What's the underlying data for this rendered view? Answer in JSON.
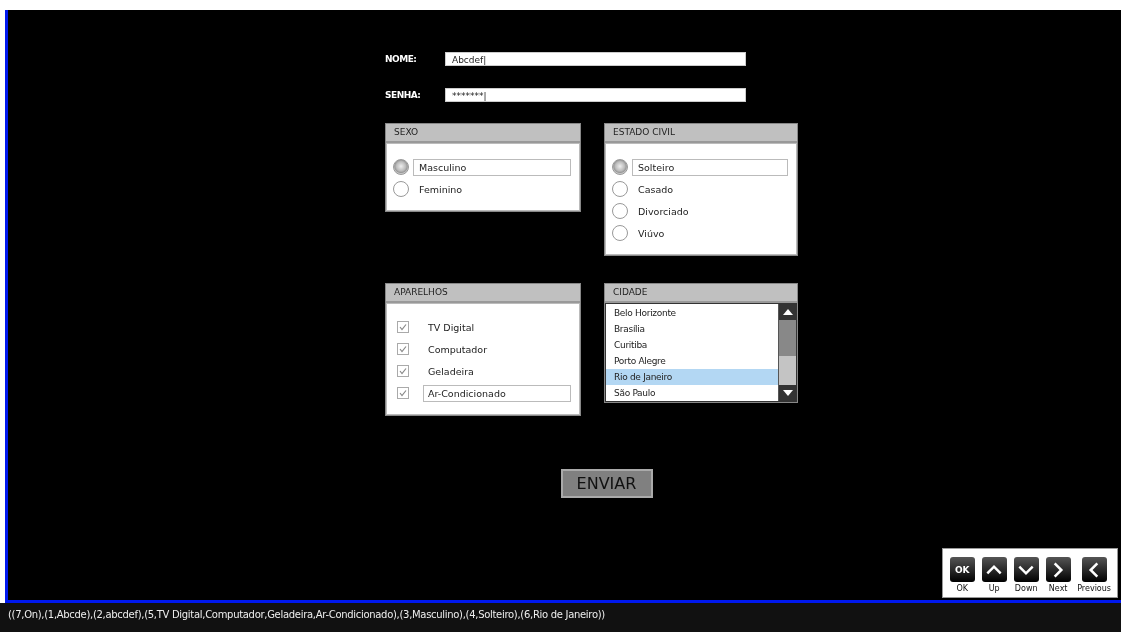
{
  "fields": [
    {
      "label": "NOME:",
      "value": "Abcdef|"
    },
    {
      "label": "SENHA:",
      "value": "*******|"
    }
  ],
  "groups": [
    {
      "kind": "radio",
      "title": "SEXO",
      "items": [
        {
          "label": "Masculino",
          "selected": true
        },
        {
          "label": "Feminino",
          "selected": false
        }
      ]
    },
    {
      "kind": "radio",
      "title": "ESTADO CIVIL",
      "items": [
        {
          "label": "Solteiro",
          "selected": true
        },
        {
          "label": "Casado",
          "selected": false
        },
        {
          "label": "Divorciado",
          "selected": false
        },
        {
          "label": "Viúvo",
          "selected": false
        }
      ]
    },
    {
      "kind": "checkbox",
      "title": "APARELHOS",
      "items": [
        {
          "label": "TV Digital",
          "checked": true,
          "focused": false
        },
        {
          "label": "Computador",
          "checked": true,
          "focused": false
        },
        {
          "label": "Geladeira",
          "checked": true,
          "focused": false
        },
        {
          "label": "Ar-Condicionado",
          "checked": true,
          "focused": true
        }
      ]
    },
    {
      "kind": "list",
      "title": "CIDADE",
      "items": [
        {
          "label": "Belo Horizonte",
          "selected": false
        },
        {
          "label": "Brasília",
          "selected": false
        },
        {
          "label": "Curitiba",
          "selected": false
        },
        {
          "label": "Porto Alegre",
          "selected": false
        },
        {
          "label": "Rio de Janeiro",
          "selected": true
        },
        {
          "label": "São Paulo",
          "selected": false
        }
      ]
    }
  ],
  "submit_button": "ENVIAR",
  "nav_buttons": [
    {
      "kind": "ok",
      "key": "OK",
      "label": "OK"
    },
    {
      "kind": "up",
      "label": "Up"
    },
    {
      "kind": "down",
      "label": "Down"
    },
    {
      "kind": "next",
      "label": "Next"
    },
    {
      "kind": "previous",
      "label": "Previous"
    }
  ],
  "status_bar": "((7,On),(1,Abcde),(2,abcdef),(5,TV Digital,Computador,Geladeira,Ar-Condicionado),(3,Masculino),(4,Solteiro),(6,Rio de Janeiro))"
}
